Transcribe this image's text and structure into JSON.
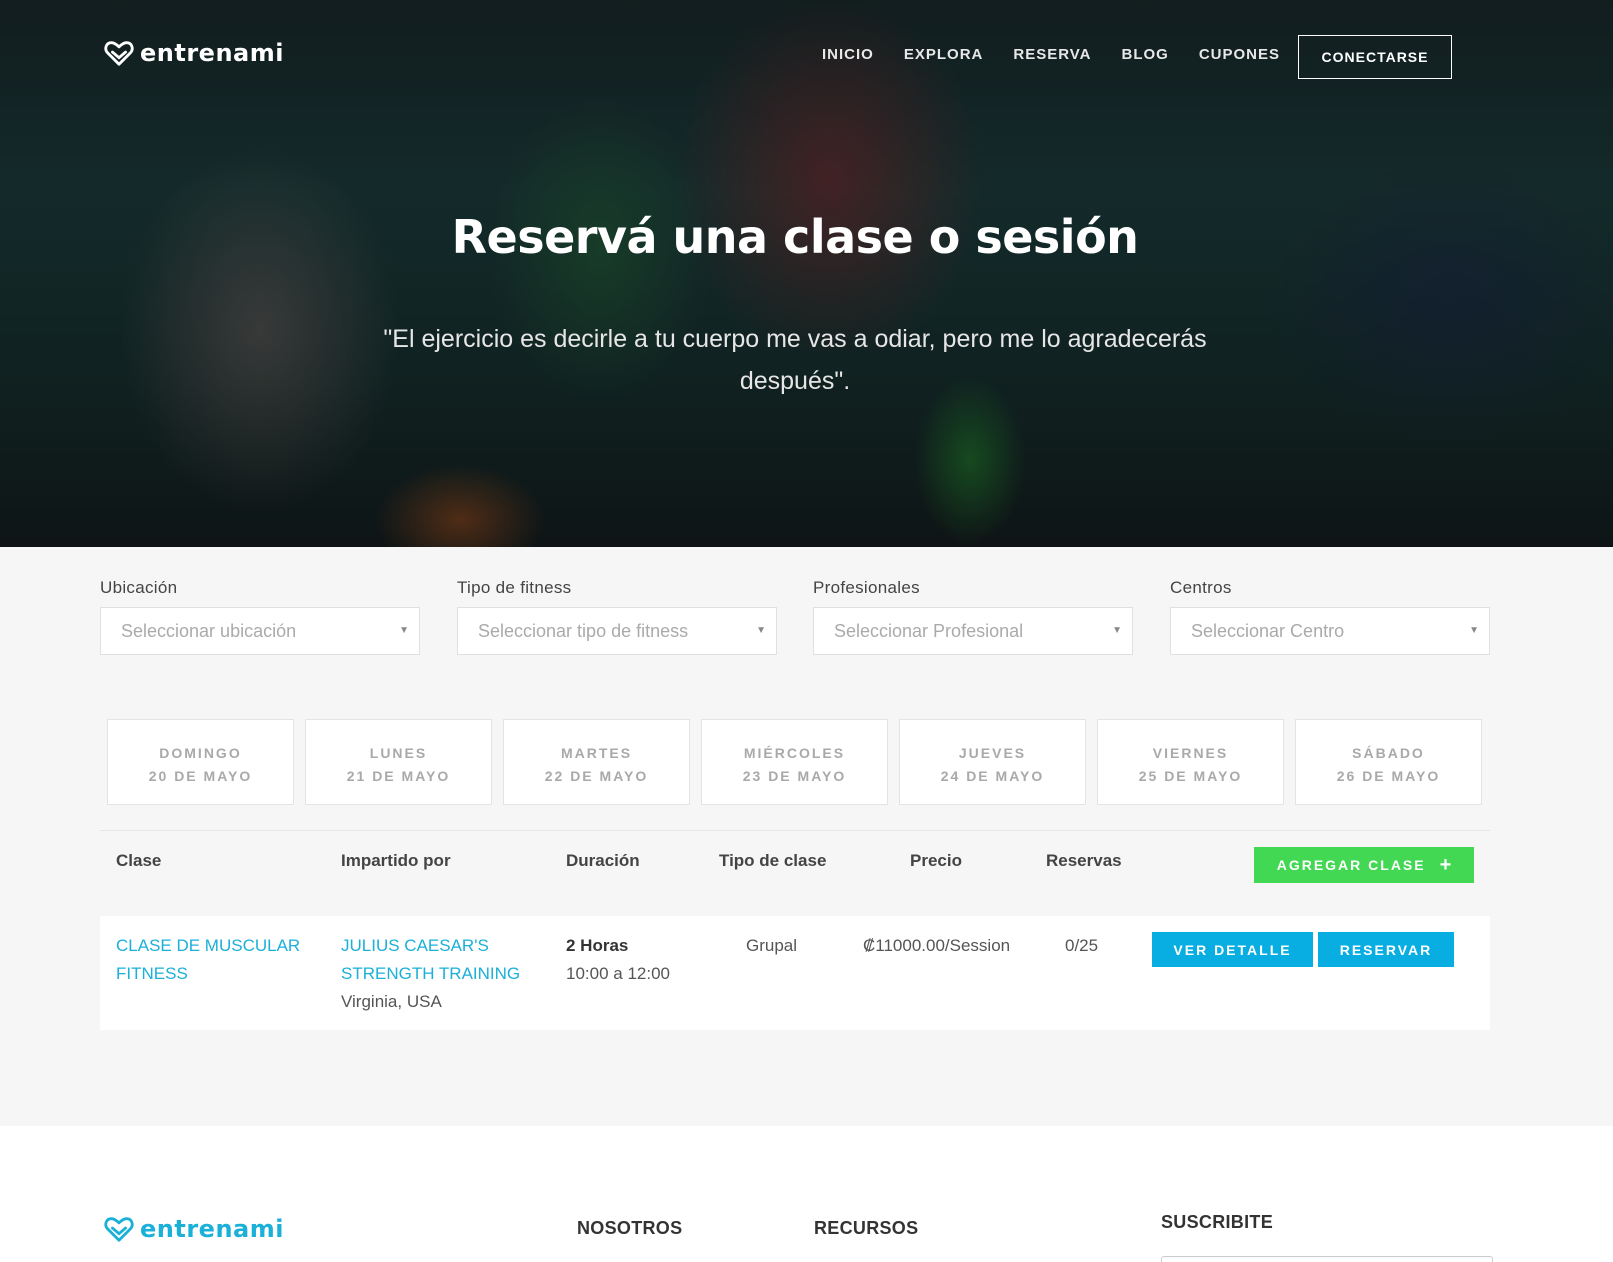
{
  "brand": {
    "name": "entrenami",
    "icon": "heart-logo-icon"
  },
  "nav": {
    "items": [
      "INICIO",
      "EXPLORA",
      "RESERVA",
      "BLOG",
      "CUPONES"
    ],
    "connect_label": "CONECTARSE"
  },
  "hero": {
    "title": "Reservá una clase o sesión",
    "quote": "\"El ejercicio es decirle a tu cuerpo me vas a odiar, pero me lo agradecerás después\"."
  },
  "filters": [
    {
      "label": "Ubicación",
      "placeholder": "Seleccionar ubicación"
    },
    {
      "label": "Tipo de fitness",
      "placeholder": "Seleccionar tipo de fitness"
    },
    {
      "label": "Profesionales",
      "placeholder": "Seleccionar Profesional"
    },
    {
      "label": "Centros",
      "placeholder": "Seleccionar Centro"
    }
  ],
  "days": [
    {
      "name": "DOMINGO",
      "date": "20 DE MAYO"
    },
    {
      "name": "LUNES",
      "date": "21 DE MAYO"
    },
    {
      "name": "MARTES",
      "date": "22 DE MAYO"
    },
    {
      "name": "MIÉRCOLES",
      "date": "23 DE MAYO"
    },
    {
      "name": "JUEVES",
      "date": "24 DE MAYO"
    },
    {
      "name": "VIERNES",
      "date": "25 DE MAYO"
    },
    {
      "name": "SÁBADO",
      "date": "26 DE MAYO"
    }
  ],
  "table": {
    "headers": {
      "clase": "Clase",
      "impartido": "Impartido por",
      "duracion": "Duración",
      "tipo": "Tipo de clase",
      "precio": "Precio",
      "reservas": "Reservas"
    },
    "add_label": "AGREGAR CLASE",
    "add_icon": "plus-icon",
    "rows": [
      {
        "clase_line1": "CLASE DE MUSCULAR",
        "clase_line2": "FITNESS",
        "impartido_line1": "JULIUS CAESAR'S",
        "impartido_line2": "STRENGTH TRAINING",
        "location": "Virginia, USA",
        "duracion": "2 Horas",
        "horario": "10:00 a 12:00",
        "tipo": "Grupal",
        "precio": "₡11000.00/Session",
        "reservas": "0/25",
        "detail_label": "VER DETALLE",
        "reserve_label": "RESERVAR"
      }
    ]
  },
  "footer": {
    "brand": "entrenami",
    "headings": [
      "NOSOTROS",
      "RECURSOS",
      "SUSCRIBITE"
    ]
  },
  "colors": {
    "accent_blue": "#08aee2",
    "link_blue": "#1ab0d8",
    "add_green": "#43d854"
  }
}
